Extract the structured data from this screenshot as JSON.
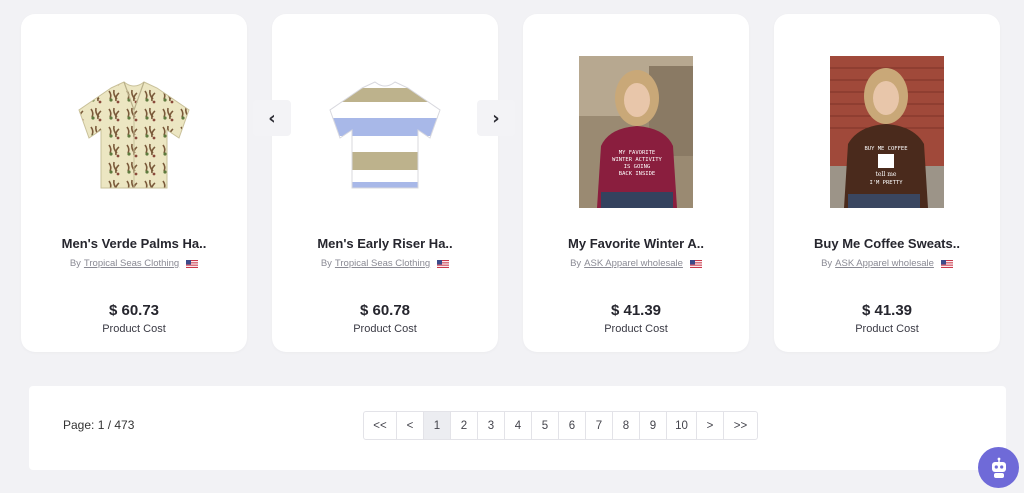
{
  "products": [
    {
      "title": "Men's Verde Palms Ha..",
      "by": "By",
      "seller": "Tropical Seas Clothing",
      "price": "$ 60.73",
      "cost_label": "Product Cost"
    },
    {
      "title": "Men's Early Riser Ha..",
      "by": "By",
      "seller": "Tropical Seas Clothing",
      "price": "$ 60.78",
      "cost_label": "Product Cost"
    },
    {
      "title": "My Favorite Winter A..",
      "by": "By",
      "seller": "ASK Apparel wholesale",
      "price": "$ 41.39",
      "cost_label": "Product Cost"
    },
    {
      "title": "Buy Me Coffee Sweats..",
      "by": "By",
      "seller": "ASK Apparel wholesale",
      "price": "$ 41.39",
      "cost_label": "Product Cost"
    }
  ],
  "carousel": {
    "prev": "‹",
    "next": "›"
  },
  "pagination": {
    "page_info": "Page: 1 / 473",
    "first": "<<",
    "prev": "<",
    "pages": [
      "1",
      "2",
      "3",
      "4",
      "5",
      "6",
      "7",
      "8",
      "9",
      "10"
    ],
    "next": ">",
    "last": ">>",
    "active": "1"
  },
  "colors": {
    "background": "#f2f2f5",
    "card": "#ffffff",
    "chat_bot": "#6f6ad8"
  },
  "icons": {
    "chat": "robot-icon",
    "flag": "us-flag-icon"
  }
}
